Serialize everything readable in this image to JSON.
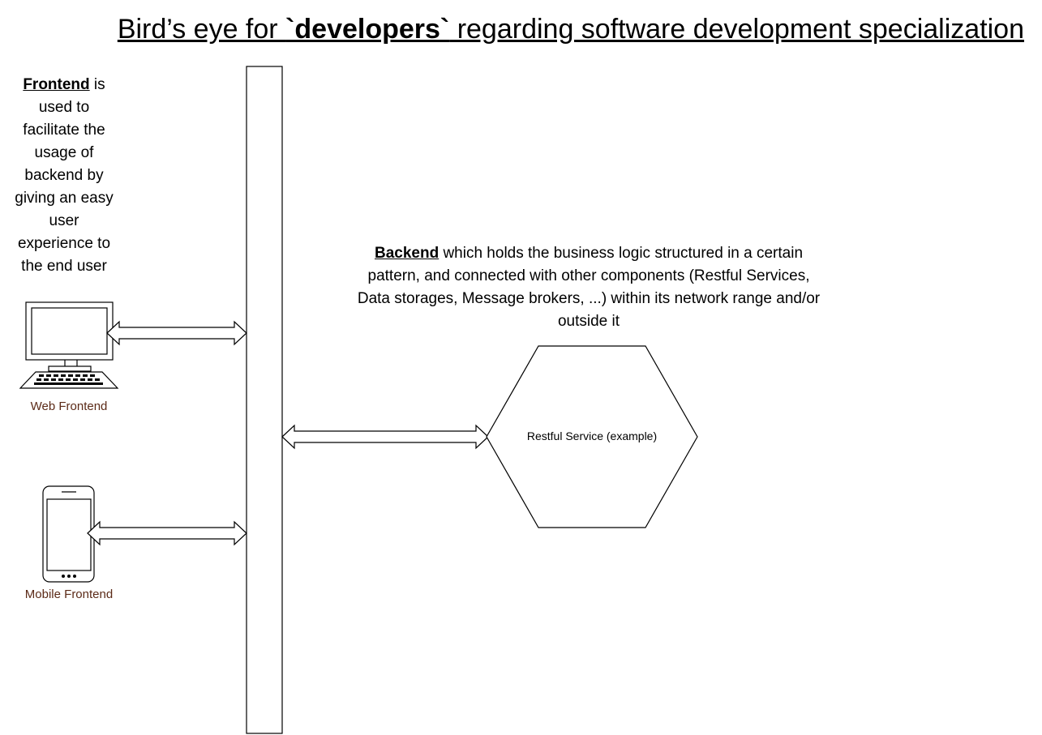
{
  "title": {
    "prefix": "Bird’s eye for ",
    "bold": "`developers`",
    "suffix": " regarding software development specialization"
  },
  "frontend_desc": {
    "bold": "Frontend",
    "line1_rest": " is",
    "lines": [
      "used to",
      "facilitate the",
      "usage of",
      "backend by",
      "giving an easy",
      "user",
      "experience to",
      "the end user"
    ]
  },
  "backend_desc": {
    "bold": "Backend",
    "line1_rest": " which holds the business logic structured in a certain",
    "lines": [
      "pattern, and connected with other components (Restful Services,",
      "Data storages, Message brokers, ...) within its network range and/or",
      "outside it"
    ]
  },
  "web_frontend": {
    "label": "Web Frontend",
    "icon": "desktop-computer-icon"
  },
  "mobile_frontend": {
    "label": "Mobile Frontend",
    "icon": "mobile-phone-icon"
  },
  "restful_service": {
    "label": "Restful Service (example)",
    "shape": "hexagon"
  },
  "colors": {
    "caption": "#5b2a17",
    "stroke": "#000000"
  }
}
